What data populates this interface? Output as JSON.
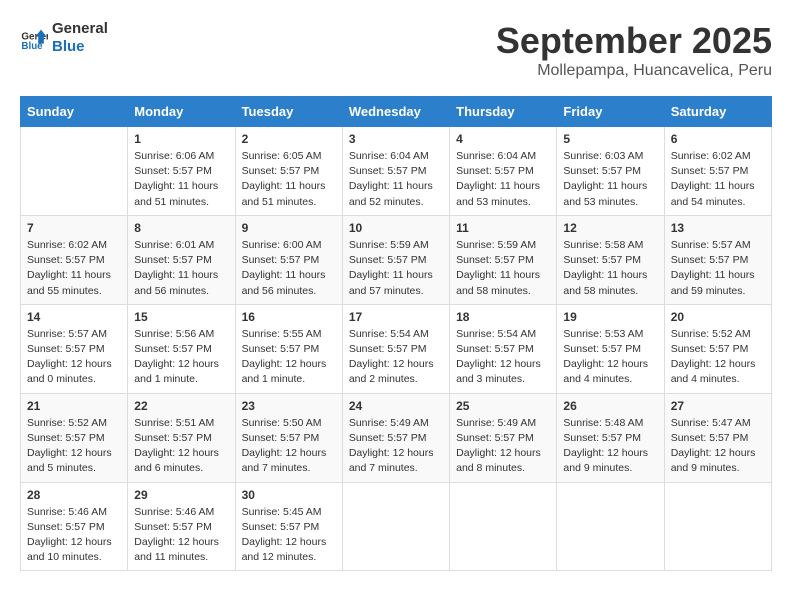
{
  "header": {
    "logo_line1": "General",
    "logo_line2": "Blue",
    "month": "September 2025",
    "location": "Mollepampa, Huancavelica, Peru"
  },
  "days_of_week": [
    "Sunday",
    "Monday",
    "Tuesday",
    "Wednesday",
    "Thursday",
    "Friday",
    "Saturday"
  ],
  "weeks": [
    [
      {
        "day": "",
        "info": ""
      },
      {
        "day": "1",
        "info": "Sunrise: 6:06 AM\nSunset: 5:57 PM\nDaylight: 11 hours\nand 51 minutes."
      },
      {
        "day": "2",
        "info": "Sunrise: 6:05 AM\nSunset: 5:57 PM\nDaylight: 11 hours\nand 51 minutes."
      },
      {
        "day": "3",
        "info": "Sunrise: 6:04 AM\nSunset: 5:57 PM\nDaylight: 11 hours\nand 52 minutes."
      },
      {
        "day": "4",
        "info": "Sunrise: 6:04 AM\nSunset: 5:57 PM\nDaylight: 11 hours\nand 53 minutes."
      },
      {
        "day": "5",
        "info": "Sunrise: 6:03 AM\nSunset: 5:57 PM\nDaylight: 11 hours\nand 53 minutes."
      },
      {
        "day": "6",
        "info": "Sunrise: 6:02 AM\nSunset: 5:57 PM\nDaylight: 11 hours\nand 54 minutes."
      }
    ],
    [
      {
        "day": "7",
        "info": "Sunrise: 6:02 AM\nSunset: 5:57 PM\nDaylight: 11 hours\nand 55 minutes."
      },
      {
        "day": "8",
        "info": "Sunrise: 6:01 AM\nSunset: 5:57 PM\nDaylight: 11 hours\nand 56 minutes."
      },
      {
        "day": "9",
        "info": "Sunrise: 6:00 AM\nSunset: 5:57 PM\nDaylight: 11 hours\nand 56 minutes."
      },
      {
        "day": "10",
        "info": "Sunrise: 5:59 AM\nSunset: 5:57 PM\nDaylight: 11 hours\nand 57 minutes."
      },
      {
        "day": "11",
        "info": "Sunrise: 5:59 AM\nSunset: 5:57 PM\nDaylight: 11 hours\nand 58 minutes."
      },
      {
        "day": "12",
        "info": "Sunrise: 5:58 AM\nSunset: 5:57 PM\nDaylight: 11 hours\nand 58 minutes."
      },
      {
        "day": "13",
        "info": "Sunrise: 5:57 AM\nSunset: 5:57 PM\nDaylight: 11 hours\nand 59 minutes."
      }
    ],
    [
      {
        "day": "14",
        "info": "Sunrise: 5:57 AM\nSunset: 5:57 PM\nDaylight: 12 hours\nand 0 minutes."
      },
      {
        "day": "15",
        "info": "Sunrise: 5:56 AM\nSunset: 5:57 PM\nDaylight: 12 hours\nand 1 minute."
      },
      {
        "day": "16",
        "info": "Sunrise: 5:55 AM\nSunset: 5:57 PM\nDaylight: 12 hours\nand 1 minute."
      },
      {
        "day": "17",
        "info": "Sunrise: 5:54 AM\nSunset: 5:57 PM\nDaylight: 12 hours\nand 2 minutes."
      },
      {
        "day": "18",
        "info": "Sunrise: 5:54 AM\nSunset: 5:57 PM\nDaylight: 12 hours\nand 3 minutes."
      },
      {
        "day": "19",
        "info": "Sunrise: 5:53 AM\nSunset: 5:57 PM\nDaylight: 12 hours\nand 4 minutes."
      },
      {
        "day": "20",
        "info": "Sunrise: 5:52 AM\nSunset: 5:57 PM\nDaylight: 12 hours\nand 4 minutes."
      }
    ],
    [
      {
        "day": "21",
        "info": "Sunrise: 5:52 AM\nSunset: 5:57 PM\nDaylight: 12 hours\nand 5 minutes."
      },
      {
        "day": "22",
        "info": "Sunrise: 5:51 AM\nSunset: 5:57 PM\nDaylight: 12 hours\nand 6 minutes."
      },
      {
        "day": "23",
        "info": "Sunrise: 5:50 AM\nSunset: 5:57 PM\nDaylight: 12 hours\nand 7 minutes."
      },
      {
        "day": "24",
        "info": "Sunrise: 5:49 AM\nSunset: 5:57 PM\nDaylight: 12 hours\nand 7 minutes."
      },
      {
        "day": "25",
        "info": "Sunrise: 5:49 AM\nSunset: 5:57 PM\nDaylight: 12 hours\nand 8 minutes."
      },
      {
        "day": "26",
        "info": "Sunrise: 5:48 AM\nSunset: 5:57 PM\nDaylight: 12 hours\nand 9 minutes."
      },
      {
        "day": "27",
        "info": "Sunrise: 5:47 AM\nSunset: 5:57 PM\nDaylight: 12 hours\nand 9 minutes."
      }
    ],
    [
      {
        "day": "28",
        "info": "Sunrise: 5:46 AM\nSunset: 5:57 PM\nDaylight: 12 hours\nand 10 minutes."
      },
      {
        "day": "29",
        "info": "Sunrise: 5:46 AM\nSunset: 5:57 PM\nDaylight: 12 hours\nand 11 minutes."
      },
      {
        "day": "30",
        "info": "Sunrise: 5:45 AM\nSunset: 5:57 PM\nDaylight: 12 hours\nand 12 minutes."
      },
      {
        "day": "",
        "info": ""
      },
      {
        "day": "",
        "info": ""
      },
      {
        "day": "",
        "info": ""
      },
      {
        "day": "",
        "info": ""
      }
    ]
  ]
}
